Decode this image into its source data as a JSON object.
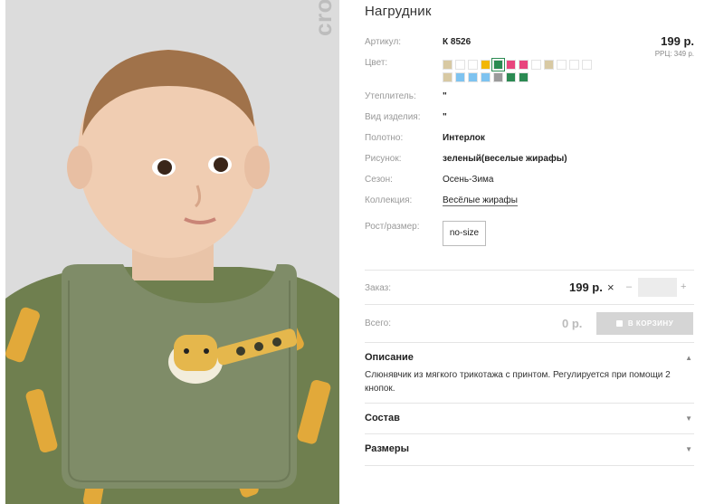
{
  "product": {
    "title": "Нагрудник",
    "brand": "crockid",
    "article_label": "Артикул:",
    "article_value": "К 8526",
    "price": "199 р.",
    "rrc": "РРЦ: 349 р.",
    "color_label": "Цвет:",
    "swatch_colors": [
      "#d8c9a3",
      "#ffffff",
      "#ffffff",
      "#f2b705",
      "#2b8a52",
      "#e8457d",
      "#e8457d",
      "#ffffff",
      "#d8c9a3",
      "#ffffff",
      "#ffffff",
      "#ffffff",
      "#d8c9a3",
      "#7ec3f0",
      "#7ec3f0",
      "#7ec3f0",
      "#9b9b9b",
      "#2b8a52",
      "#2b8a52"
    ],
    "selected_swatch": 4,
    "insulation_label": "Утеплитель:",
    "insulation_value": "\"",
    "type_label": "Вид изделия:",
    "type_value": "\"",
    "fabric_label": "Полотно:",
    "fabric_value": "Интерлок",
    "print_label": "Рисунок:",
    "print_value": "зеленый(веселые жирафы)",
    "season_label": "Сезон:",
    "season_value": "Осень-Зима",
    "collection_label": "Коллекция:",
    "collection_value": "Весёлые жирафы",
    "size_label": "Рост/размер:",
    "size_value": "no-size"
  },
  "order": {
    "order_label": "Заказ:",
    "order_price": "199 р.",
    "times": "×",
    "minus": "–",
    "plus": "+",
    "total_label": "Всего:",
    "total_value": "0 р.",
    "cart_button": "В КОРЗИНУ"
  },
  "sections": {
    "description_title": "Описание",
    "description_text": "Слюнявчик из мягкого трикотажа с принтом. Регулируется при помощи 2 кнопок.",
    "composition_title": "Состав",
    "sizes_title": "Размеры",
    "chevron_up": "▲",
    "chevron_down": "▼"
  }
}
